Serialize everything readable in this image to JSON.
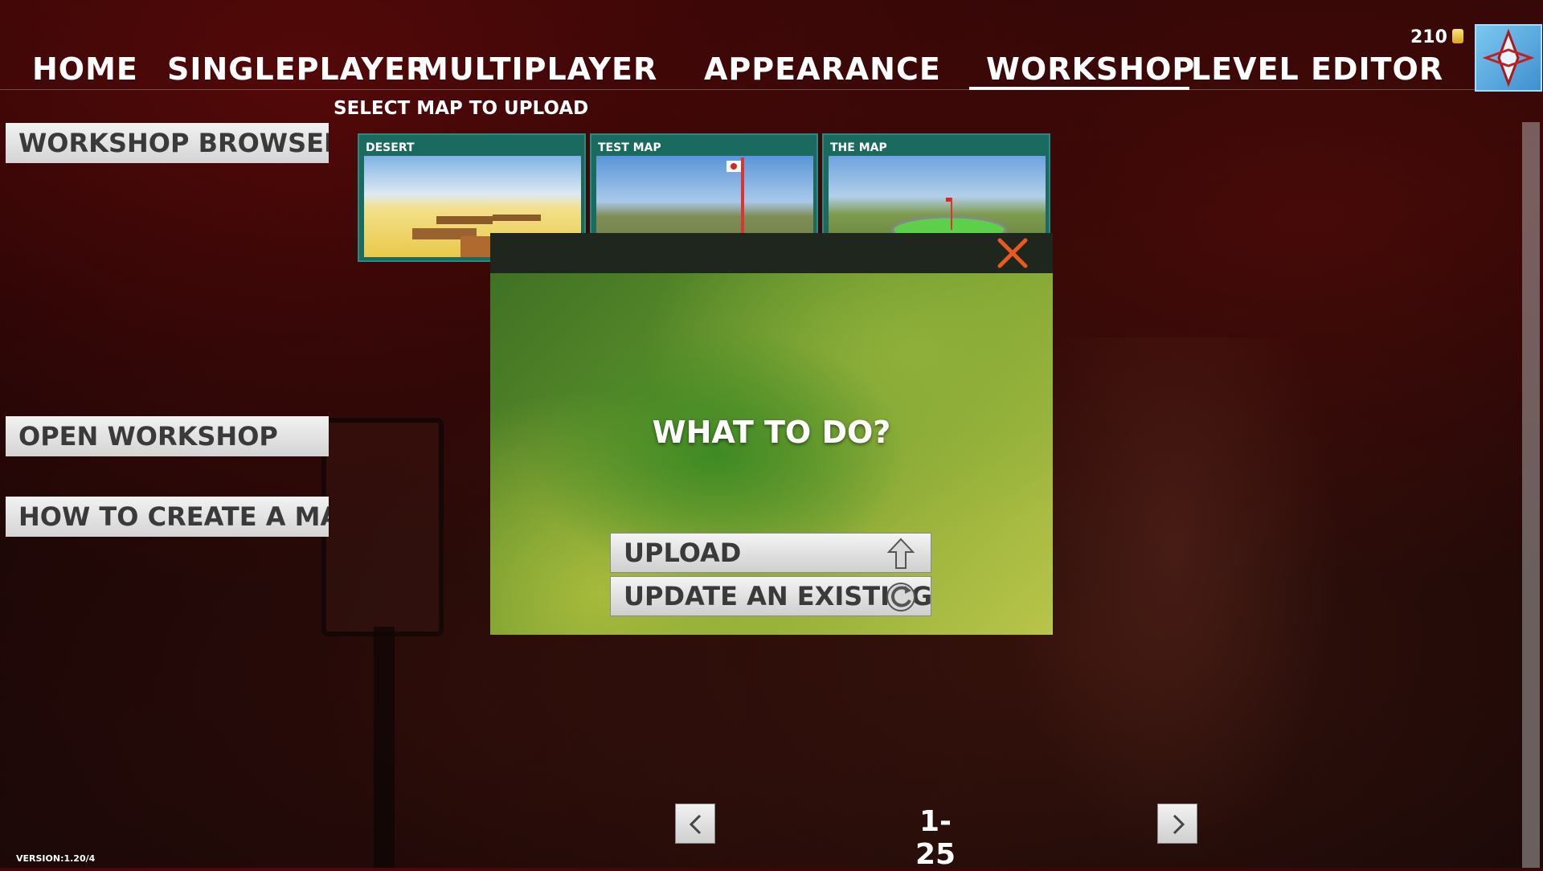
{
  "nav": {
    "tabs": [
      {
        "label": "HOME"
      },
      {
        "label": "SINGLEPLAYER"
      },
      {
        "label": "MULTIPLAYER"
      },
      {
        "label": "APPEARANCE"
      },
      {
        "label": "WORKSHOP",
        "active": true
      },
      {
        "label": "LEVEL EDITOR"
      }
    ],
    "coins": "210",
    "avatar_icon": "avatar-icon"
  },
  "sidebar": {
    "workshop_browser": "WORKSHOP BROWSER",
    "open_workshop": "OPEN WORKSHOP",
    "how_to_create": "HOW TO CREATE A MAP"
  },
  "main": {
    "select_label": "SELECT MAP TO UPLOAD",
    "maps": [
      {
        "title": "DESERT"
      },
      {
        "title": "TEST MAP"
      },
      {
        "title": "THE MAP"
      }
    ]
  },
  "modal": {
    "title": "WHAT TO DO?",
    "upload_label": "UPLOAD",
    "update_label": "UPDATE AN EXISTING",
    "close_icon": "close-icon",
    "accent_color": "#e85a1e"
  },
  "pager": {
    "range": "1-25"
  },
  "footer": {
    "version": "VERSION:1.20/4"
  }
}
